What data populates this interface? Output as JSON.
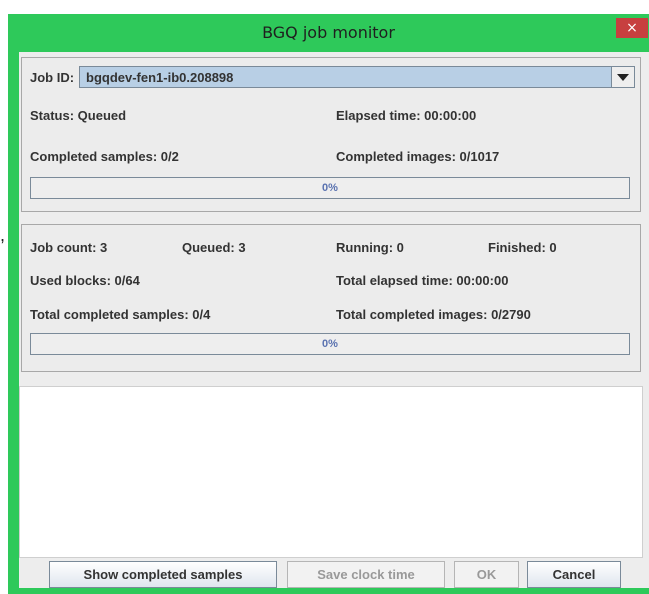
{
  "background": {
    "mark": ","
  },
  "window": {
    "title": "BGQ job monitor",
    "close_glyph": "×",
    "title_color": "#2ec95a",
    "close_color": "#c73f3f"
  },
  "job": {
    "id_label": "Job ID:",
    "id_value": "bgqdev-fen1-ib0.208898",
    "status": "Status: Queued",
    "elapsed": "Elapsed time: 00:00:00",
    "completed_samples": "Completed samples: 0/2",
    "completed_images": "Completed images: 0/1017",
    "progress_text": "0%",
    "progress_value": 0
  },
  "summary": {
    "job_count": "Job count: 3",
    "queued": "Queued: 3",
    "running": "Running: 0",
    "finished": "Finished: 0",
    "used_blocks": "Used blocks: 0/64",
    "total_elapsed": "Total elapsed time: 00:00:00",
    "total_samples": "Total completed samples: 0/4",
    "total_images": "Total completed images: 0/2790",
    "progress_text": "0%",
    "progress_value": 0
  },
  "buttons": {
    "show_completed": "Show completed samples",
    "save_clock": "Save clock time",
    "ok": "OK",
    "cancel": "Cancel"
  },
  "icons": {
    "close": "close-icon",
    "dropdown": "chevron-down-icon"
  }
}
